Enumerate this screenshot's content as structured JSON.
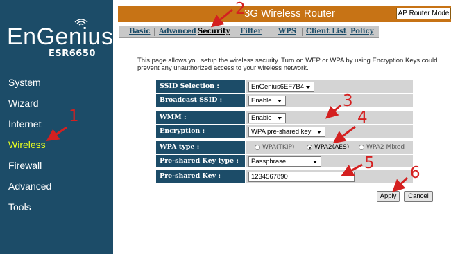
{
  "brand": {
    "logo_text": "EnGenius",
    "model": "ESR6650"
  },
  "sidebar": {
    "items": [
      {
        "label": "System"
      },
      {
        "label": "Wizard"
      },
      {
        "label": "Internet"
      },
      {
        "label": "Wireless",
        "active": true
      },
      {
        "label": "Firewall"
      },
      {
        "label": "Advanced"
      },
      {
        "label": "Tools"
      }
    ]
  },
  "header": {
    "title": "3G Wireless Router",
    "mode": "AP Router Mode"
  },
  "tabs": [
    {
      "label": "Basic"
    },
    {
      "label": "Advanced"
    },
    {
      "label": "Security",
      "active": true
    },
    {
      "label": "Filter"
    },
    {
      "label": "WPS"
    },
    {
      "label": "Client List"
    },
    {
      "label": "Policy"
    }
  ],
  "description": "This page allows you setup the wireless security. Turn on WEP or WPA by using Encryption Keys could prevent any unauthorized access to your wireless network.",
  "form": {
    "ssid_selection": {
      "label": "SSID Selection :",
      "value": "EnGenius6EF7B4"
    },
    "broadcast_ssid": {
      "label": "Broadcast SSID :",
      "value": "Enable"
    },
    "wmm": {
      "label": "WMM :",
      "value": "Enable"
    },
    "encryption": {
      "label": "Encryption :",
      "value": "WPA pre-shared key"
    },
    "wpa_type": {
      "label": "WPA type :",
      "options": [
        {
          "label": "WPA(TKIP)",
          "selected": false
        },
        {
          "label": "WPA2(AES)",
          "selected": true
        },
        {
          "label": "WPA2 Mixed",
          "selected": false
        }
      ]
    },
    "psk_type": {
      "label": "Pre-shared Key type :",
      "value": "Passphrase"
    },
    "psk": {
      "label": "Pre-shared Key :",
      "value": "1234567890"
    }
  },
  "buttons": {
    "apply": "Apply",
    "cancel": "Cancel"
  },
  "annotations": {
    "color": "#d42020",
    "step_1": "1",
    "step_2": "2",
    "step_3": "3",
    "step_4": "4",
    "step_5": "5",
    "step_6": "6"
  },
  "colors": {
    "sidebar": "#1c4c68",
    "header": "#c77315",
    "active_nav": "#e8ff20"
  }
}
